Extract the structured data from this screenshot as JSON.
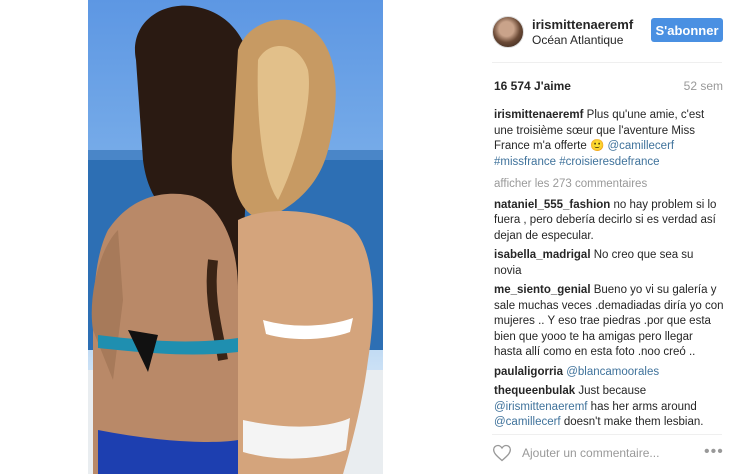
{
  "post": {
    "username": "irismittenaeremf",
    "location": "Océan Atlantique",
    "follow_label": "S'abonner",
    "likes": "16 574 J'aime",
    "age": "52 sem"
  },
  "caption": {
    "author": "irismittenaeremf",
    "text": " Plus qu'une amie, c'est une troisième sœur que l'aventure Miss France m'a offerte 🙂 ",
    "mention": "@camillecerf",
    "hashtag1": "#missfrance",
    "hashtag2": "#croisieresdefrance"
  },
  "load_more": "afficher les 273 commentaires",
  "comments": [
    {
      "author": "nataniel_555_fashion",
      "text": " no hay problem si lo fuera , pero debería decirlo si es verdad así dejan de especular."
    },
    {
      "author": "isabella_madrigal",
      "text": " No creo que sea su novia"
    },
    {
      "author": "me_siento_genial",
      "text": " Bueno yo vi su galería y sale muchas veces .demadiadas diría yo con mujeres .. Y eso trae piedras .por que esta bien que yooo te ha amigas pero llegar hasta allí como en esta foto .noo creó .."
    },
    {
      "author": "paulaligorria",
      "mention": "@blancamoorales"
    },
    {
      "author": "thequeenbulak",
      "text_a": " Just because ",
      "mention_a": "@irismittenaeremf",
      "text_b": " has her arms around ",
      "mention_b": "@camillecerf",
      "text_c": " doesn't make them lesbian."
    }
  ],
  "add_comment_placeholder": "Ajouter un commentaire...",
  "icons": {
    "like": "heart-outline-icon",
    "options": "more-options-icon"
  },
  "colors": {
    "button": "#4a90e2",
    "link": "#3f729b",
    "muted": "#999999"
  }
}
